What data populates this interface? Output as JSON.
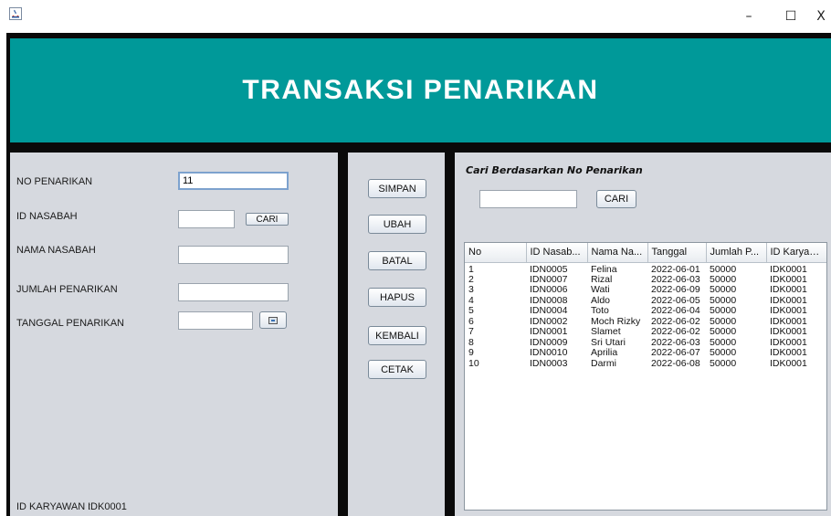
{
  "window": {
    "minimize_glyph": "–",
    "maximize_glyph": "☐",
    "close_glyph": "X"
  },
  "header": {
    "title": "TRANSAKSI PENARIKAN"
  },
  "form": {
    "no_penarikan_label": "NO PENARIKAN",
    "no_penarikan_value": "11",
    "id_nasabah_label": "ID NASABAH",
    "id_nasabah_value": "",
    "cari_label": "CARI",
    "nama_nasabah_label": "NAMA NASABAH",
    "nama_nasabah_value": "",
    "jumlah_penarikan_label": "JUMLAH PENARIKAN",
    "jumlah_penarikan_value": "",
    "tanggal_penarikan_label": "TANGGAL PENARIKAN",
    "tanggal_penarikan_value": "",
    "id_karyawan_label": "ID KARYAWAN :",
    "id_karyawan_value": "IDK0001"
  },
  "actions": {
    "simpan": "SIMPAN",
    "ubah": "UBAH",
    "batal": "BATAL",
    "hapus": "HAPUS",
    "kembali": "KEMBALI",
    "cetak": "CETAK"
  },
  "search": {
    "title": "Cari Berdasarkan No Penarikan",
    "value": "",
    "button": "CARI"
  },
  "table": {
    "columns": [
      "No",
      "ID Nasab...",
      "Nama Na...",
      "Tanggal",
      "Jumlah P...",
      "ID Karyaw..."
    ],
    "rows": [
      [
        "1",
        "IDN0005",
        "Felina",
        "2022-06-01",
        "50000",
        "IDK0001"
      ],
      [
        "2",
        "IDN0007",
        "Rizal",
        "2022-06-03",
        "50000",
        "IDK0001"
      ],
      [
        "3",
        "IDN0006",
        "Wati",
        "2022-06-09",
        "50000",
        "IDK0001"
      ],
      [
        "4",
        "IDN0008",
        "Aldo",
        "2022-06-05",
        "50000",
        "IDK0001"
      ],
      [
        "5",
        "IDN0004",
        "Toto",
        "2022-06-04",
        "50000",
        "IDK0001"
      ],
      [
        "6",
        "IDN0002",
        "Moch Rizky",
        "2022-06-02",
        "50000",
        "IDK0001"
      ],
      [
        "7",
        "IDN0001",
        "Slamet",
        "2022-06-02",
        "50000",
        "IDK0001"
      ],
      [
        "8",
        "IDN0009",
        "Sri Utari",
        "2022-06-03",
        "50000",
        "IDK0001"
      ],
      [
        "9",
        "IDN0010",
        "Aprilia",
        "2022-06-07",
        "50000",
        "IDK0001"
      ],
      [
        "10",
        "IDN0003",
        "Darmi",
        "2022-06-08",
        "50000",
        "IDK0001"
      ]
    ]
  },
  "colors": {
    "header_teal": "#009999",
    "panel_gray": "#d6d9df",
    "frame_black": "#0a0a0a"
  }
}
